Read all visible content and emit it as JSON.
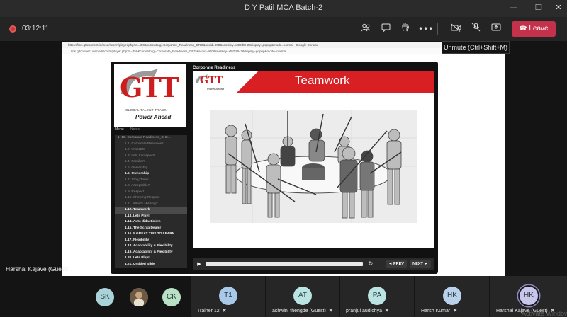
{
  "window": {
    "title": "D Y Patil MCA Batch-2",
    "minimize_icon": "minimize-icon",
    "restore_icon": "restore-icon",
    "close_icon": "close-icon"
  },
  "toolbar": {
    "recording_time": "03:12:11",
    "leave_label": "Leave",
    "tooltip": "Unmute (Ctrl+Shift+M)",
    "icons": [
      "people-icon",
      "chat-icon",
      "raise-hand-icon",
      "more-icon",
      "camera-off-icon",
      "mic-off-icon",
      "share-icon",
      "phone-icon"
    ],
    "colors": {
      "leave": "#c4314b",
      "record": "#c43b3b"
    }
  },
  "browser": {
    "window_title": "https://lms.gttconnect.in/mod/scorm/player.php?a=450&currentorg=Corporate_Readiness_ORG&scoid=900&sesskey=xt92d8H28display=popup&mode=normal - Google Chrome",
    "url": "lms.gttconnect.in/mod/scorm/player.php?a=450&currentorg=Corporate_Readiness_ORG&scoid=900&sesskey=xt92d8H28display=popup&mode=normal"
  },
  "player": {
    "logo_text": "GTT",
    "logo_subtitle": "GLOBAL TALENT TRACK",
    "logo_tagline": "Power Ahead",
    "tab_menu": "Menu",
    "tab_notes": "Notes",
    "menu": [
      {
        "label": "1. 10. Corporate Readiness_SH2...",
        "style": "parent"
      },
      {
        "label": "1.1. Corporate Readiness",
        "style": "dim"
      },
      {
        "label": "1.2. VALUES",
        "style": "dim"
      },
      {
        "label": "1.3. Lets Introspect!",
        "style": "dim"
      },
      {
        "label": "1.4. Familiar?",
        "style": "dim"
      },
      {
        "label": "1.5. Ownership",
        "style": "dim"
      },
      {
        "label": "1.6. Ownership",
        "style": "bright"
      },
      {
        "label": "1.7. Story Time!",
        "style": "dim"
      },
      {
        "label": "1.8. Acceptable?",
        "style": "dim"
      },
      {
        "label": "1.9. Respect",
        "style": "dim"
      },
      {
        "label": "1.10. Showing Respect",
        "style": "dim"
      },
      {
        "label": "1.11. What's Missing?",
        "style": "dim"
      },
      {
        "label": "1.12. Teamwork",
        "style": "active"
      },
      {
        "label": "1.13. Lets Play!",
        "style": "bright"
      },
      {
        "label": "1.14. Auto didacticism",
        "style": "bright"
      },
      {
        "label": "1.15. The Scrap Dealer",
        "style": "bright"
      },
      {
        "label": "1.16. 5 GREAT TIPS TO LEARN",
        "style": "bright"
      },
      {
        "label": "1.17. Flexibility",
        "style": "bright"
      },
      {
        "label": "1.18. Adaptability & Flexibility",
        "style": "bright"
      },
      {
        "label": "1.19. Adaptability & Flexibility",
        "style": "bright"
      },
      {
        "label": "1.20. Lets Play!",
        "style": "bright"
      },
      {
        "label": "1.21. Untitled Slide",
        "style": "bright"
      }
    ],
    "slide_header": "Corporate Readiness",
    "slide_title": "Teamwork",
    "banner_logo": "GTT",
    "banner_logo_tag": "Power Ahead",
    "prev_label": "◄ PREV",
    "next_label": "NEXT ►",
    "colors": {
      "brand_red": "#d71f24"
    }
  },
  "stage": {
    "sharer_name": "Harshal Kajave (Guest)"
  },
  "participants": [
    {
      "initials": "SK",
      "name": "",
      "color": "#a9d3d8",
      "tile": false,
      "mic_off": false
    },
    {
      "initials": "",
      "name": "",
      "color": "#7a6a55",
      "tile": false,
      "mic_off": false,
      "photo": true
    },
    {
      "initials": "CK",
      "name": "",
      "color": "#b9dfc4",
      "tile": false,
      "mic_off": false
    },
    {
      "initials": "T1",
      "name": "Trainer 12",
      "color": "#a8c9ea",
      "tile": true,
      "mic_off": true
    },
    {
      "initials": "AT",
      "name": "ashwini thengde (Guest)",
      "color": "#b9e4e2",
      "tile": true,
      "mic_off": true
    },
    {
      "initials": "PA",
      "name": "pranjul audichya",
      "color": "#b9e4e2",
      "tile": true,
      "mic_off": true
    },
    {
      "initials": "HK",
      "name": "Harsh Kumar",
      "color": "#b9d1ea",
      "tile": true,
      "mic_off": true
    },
    {
      "initials": "HK",
      "name": "Harshal Kajave (Guest)",
      "color": "#c9c6ec",
      "tile": true,
      "mic_off": true,
      "speaking": true
    }
  ],
  "watermark": "Activate Windows"
}
